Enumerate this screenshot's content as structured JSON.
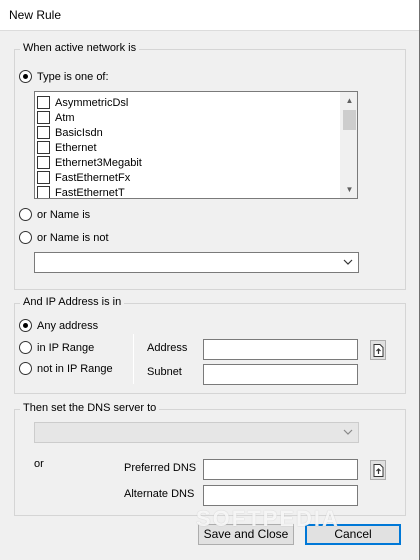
{
  "window": {
    "title": "New Rule"
  },
  "network": {
    "legend": "When active network is",
    "type_radio": "Type is one of:",
    "types": [
      "AsymmetricDsl",
      "Atm",
      "BasicIsdn",
      "Ethernet",
      "Ethernet3Megabit",
      "FastEthernetFx",
      "FastEthernetT"
    ],
    "name_is": "or Name is",
    "name_is_not": "or Name is not",
    "name_value": ""
  },
  "ip": {
    "legend": "And IP Address is in",
    "any": "Any address",
    "in_range": "in IP Range",
    "not_in_range": "not in IP Range",
    "address_label": "Address",
    "subnet_label": "Subnet",
    "address_value": "",
    "subnet_value": ""
  },
  "dns": {
    "legend": "Then set the DNS server to",
    "server_value": "",
    "or_label": "or",
    "preferred_label": "Preferred DNS",
    "alternate_label": "Alternate DNS",
    "preferred_value": "",
    "alternate_value": ""
  },
  "buttons": {
    "save": "Save and Close",
    "cancel": "Cancel"
  },
  "watermark": "SOFTPEDIA",
  "colors": {
    "accent": "#0078d7",
    "dialog_bg": "#f0f0f0"
  },
  "icons": {
    "import": "import-file-icon",
    "dropdown": "chevron-down-icon"
  }
}
